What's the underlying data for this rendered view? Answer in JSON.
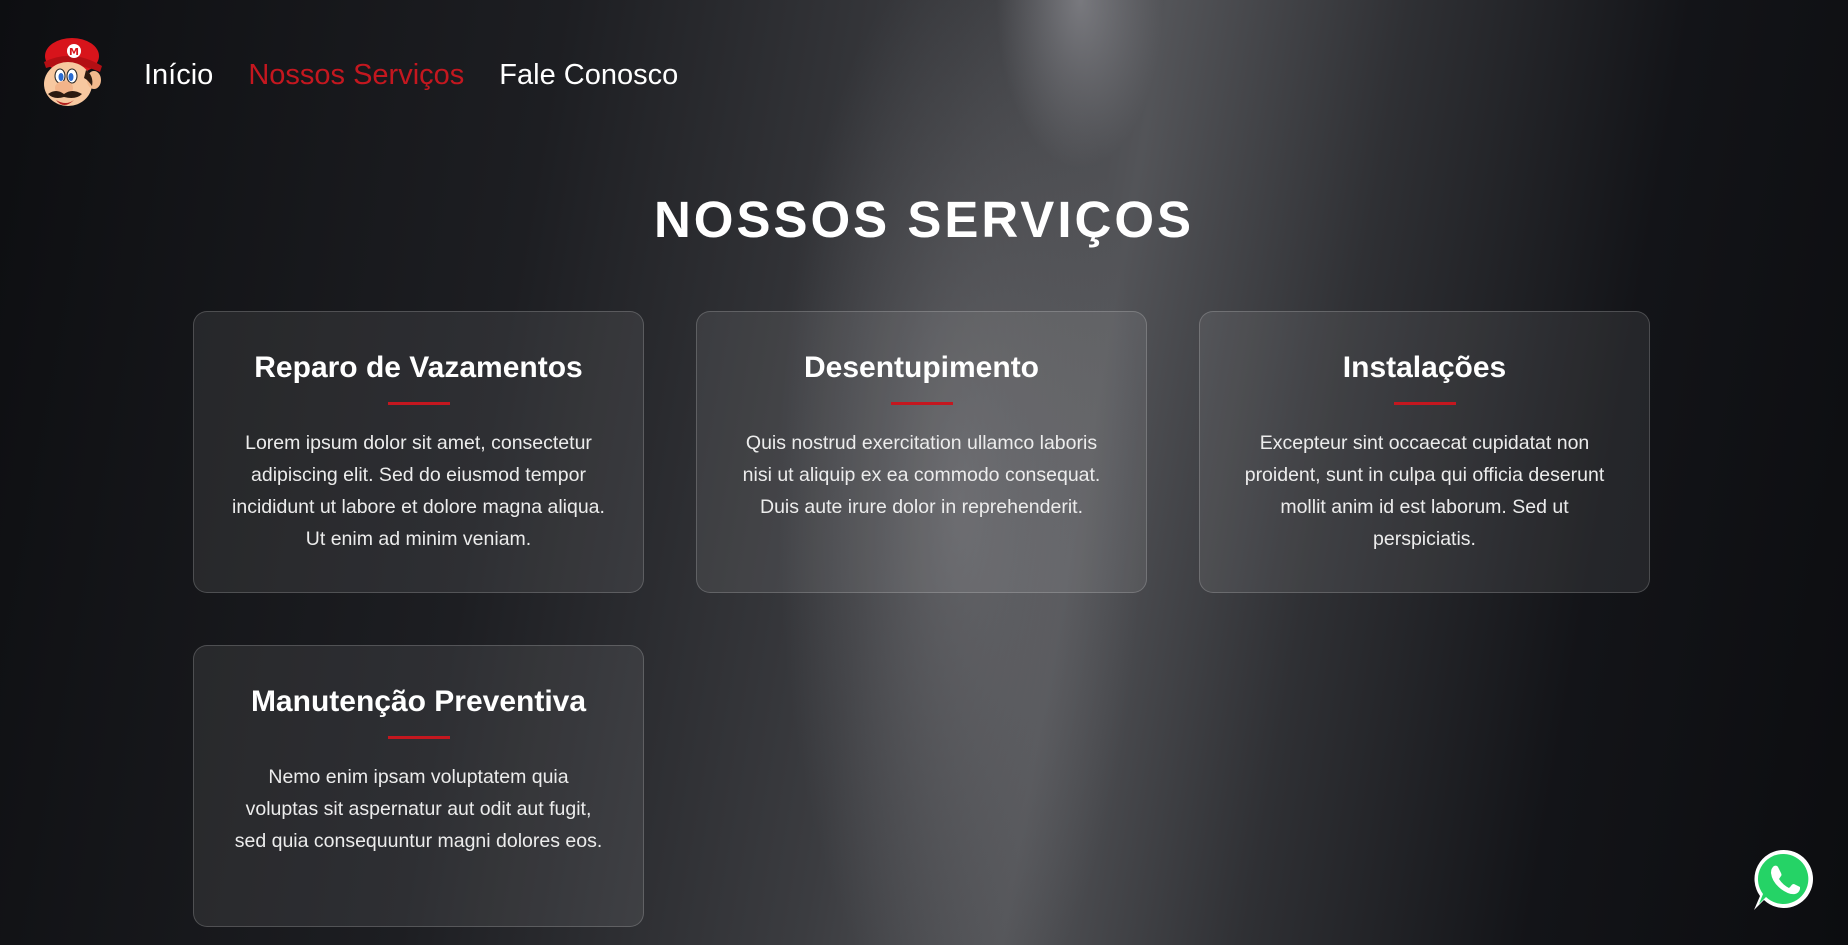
{
  "header": {
    "logo_icon": "mario-face-icon",
    "nav": [
      {
        "label": "Início",
        "active": false
      },
      {
        "label": "Nossos Serviços",
        "active": true
      },
      {
        "label": "Fale Conosco",
        "active": false
      }
    ]
  },
  "main": {
    "title": "NOSSOS SERVIÇOS",
    "cards": [
      {
        "title": "Reparo de Vazamentos",
        "text": "Lorem ipsum dolor sit amet, consectetur adipiscing elit. Sed do eiusmod tempor incididunt ut labore et dolore magna aliqua. Ut enim ad minim veniam."
      },
      {
        "title": "Desentupimento",
        "text": "Quis nostrud exercitation ullamco laboris nisi ut aliquip ex ea commodo consequat. Duis aute irure dolor in reprehenderit."
      },
      {
        "title": "Instalações",
        "text": "Excepteur sint occaecat cupidatat non proident, sunt in culpa qui officia deserunt mollit anim id est laborum. Sed ut perspiciatis."
      },
      {
        "title": "Manutenção Preventiva",
        "text": "Nemo enim ipsam voluptatem quia voluptas sit aspernatur aut odit aut fugit, sed quia consequuntur magni dolores eos."
      }
    ]
  },
  "floating": {
    "whatsapp_icon": "whatsapp-icon"
  },
  "colors": {
    "accent": "#c4171f",
    "text": "#ffffff",
    "whatsapp_green": "#25d366"
  }
}
